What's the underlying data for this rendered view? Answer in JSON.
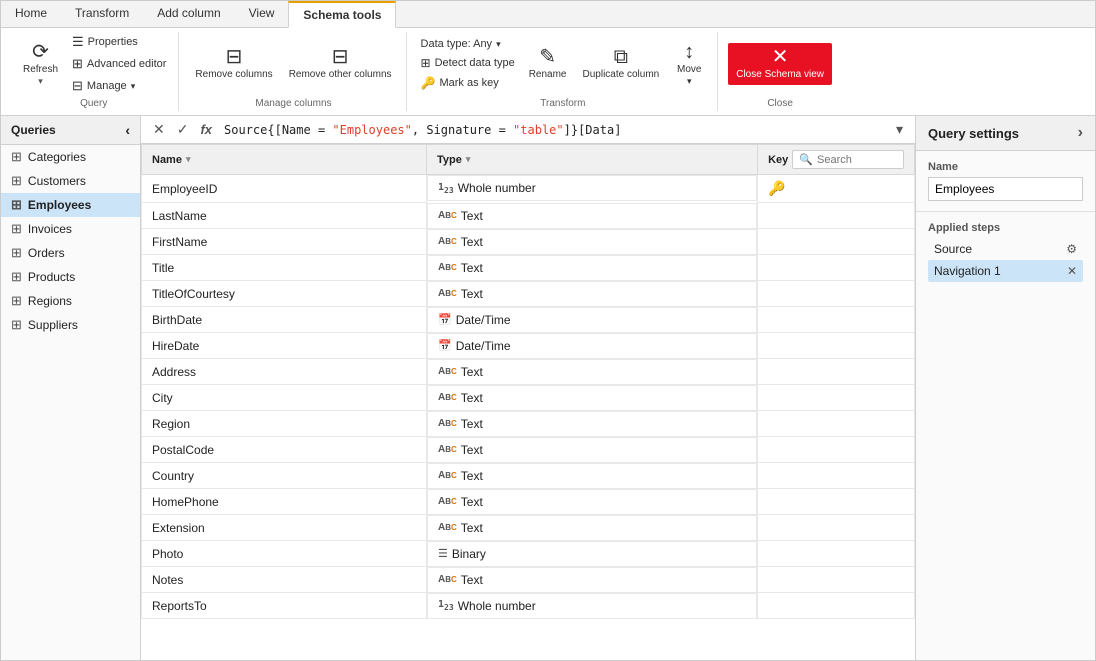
{
  "ribbon": {
    "tabs": [
      "Home",
      "Transform",
      "Add column",
      "View",
      "Schema tools"
    ],
    "active_tab": "Schema tools",
    "groups": {
      "query": {
        "label": "Query",
        "buttons": {
          "refresh": "Refresh",
          "properties": "Properties",
          "advanced_editor": "Advanced editor",
          "manage": "Manage"
        }
      },
      "manage_columns": {
        "label": "Manage columns",
        "remove_columns": "Remove\ncolumns",
        "remove_other": "Remove other\ncolumns"
      },
      "transform": {
        "label": "Transform",
        "data_type": "Data type: Any",
        "detect": "Detect data type",
        "mark_as_key": "Mark as key",
        "rename": "Rename",
        "duplicate": "Duplicate\ncolumn",
        "move": "Move"
      },
      "close": {
        "label": "Close",
        "close_schema": "Close Schema\nview"
      }
    }
  },
  "sidebar": {
    "title": "Queries",
    "items": [
      "Categories",
      "Customers",
      "Employees",
      "Invoices",
      "Orders",
      "Products",
      "Regions",
      "Suppliers"
    ],
    "active": "Employees"
  },
  "formula_bar": {
    "formula": "Source{[Name = \"Employees\", Signature = \"table\"]}[Data]",
    "formula_colored": true
  },
  "table": {
    "headers": [
      "Name",
      "Type",
      "Key"
    ],
    "rows": [
      {
        "name": "EmployeeID",
        "type_icon": "123",
        "type": "Whole number",
        "key": true
      },
      {
        "name": "LastName",
        "type_icon": "abc",
        "type": "Text",
        "key": false
      },
      {
        "name": "FirstName",
        "type_icon": "abc",
        "type": "Text",
        "key": false
      },
      {
        "name": "Title",
        "type_icon": "abc",
        "type": "Text",
        "key": false
      },
      {
        "name": "TitleOfCourtesy",
        "type_icon": "abc",
        "type": "Text",
        "key": false
      },
      {
        "name": "BirthDate",
        "type_icon": "dt",
        "type": "Date/Time",
        "key": false
      },
      {
        "name": "HireDate",
        "type_icon": "dt",
        "type": "Date/Time",
        "key": false
      },
      {
        "name": "Address",
        "type_icon": "abc",
        "type": "Text",
        "key": false
      },
      {
        "name": "City",
        "type_icon": "abc",
        "type": "Text",
        "key": false
      },
      {
        "name": "Region",
        "type_icon": "abc",
        "type": "Text",
        "key": false
      },
      {
        "name": "PostalCode",
        "type_icon": "abc",
        "type": "Text",
        "key": false
      },
      {
        "name": "Country",
        "type_icon": "abc",
        "type": "Text",
        "key": false
      },
      {
        "name": "HomePhone",
        "type_icon": "abc",
        "type": "Text",
        "key": false
      },
      {
        "name": "Extension",
        "type_icon": "abc",
        "type": "Text",
        "key": false
      },
      {
        "name": "Photo",
        "type_icon": "bin",
        "type": "Binary",
        "key": false
      },
      {
        "name": "Notes",
        "type_icon": "abc",
        "type": "Text",
        "key": false
      },
      {
        "name": "ReportsTo",
        "type_icon": "123",
        "type": "Whole number",
        "key": false
      }
    ]
  },
  "query_settings": {
    "title": "Query settings",
    "name_label": "Name",
    "name_value": "Employees",
    "applied_steps_label": "Applied steps",
    "steps": [
      {
        "label": "Source",
        "has_gear": true,
        "has_delete": false
      },
      {
        "label": "Navigation 1",
        "has_gear": false,
        "has_delete": true
      }
    ]
  }
}
